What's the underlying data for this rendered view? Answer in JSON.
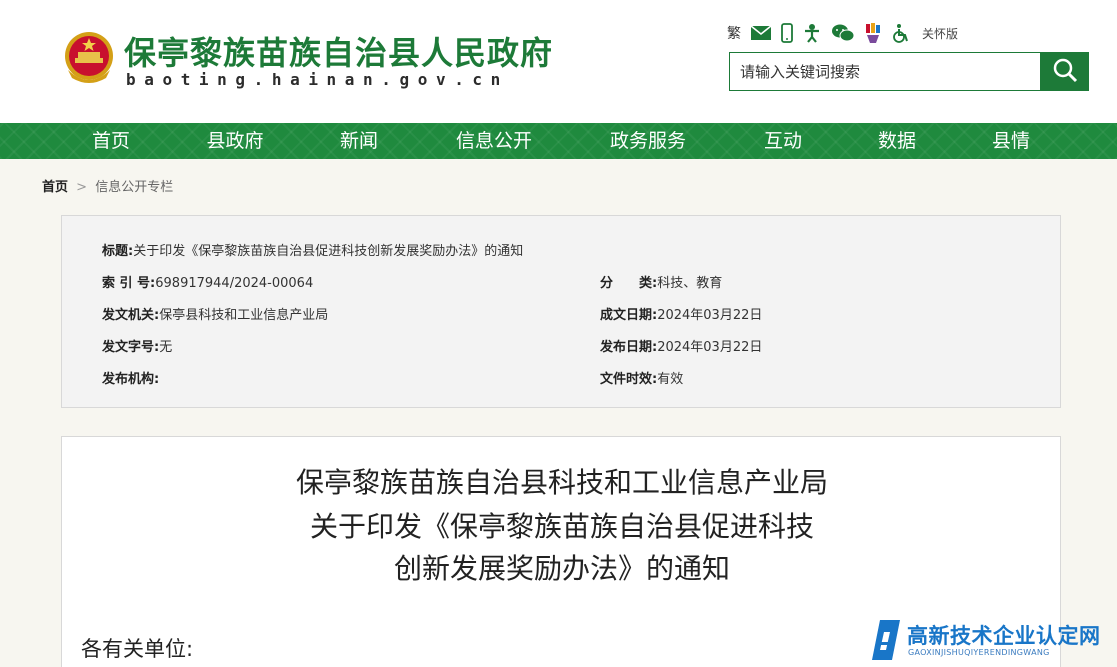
{
  "header": {
    "site_title": "保亭黎族苗族自治县人民政府",
    "site_domain": "baoting.hainan.gov.cn",
    "tools": {
      "traditional_label": "繁",
      "care_mode_label": "关怀版"
    },
    "search": {
      "placeholder": "请输入关键词搜索"
    }
  },
  "nav": {
    "items": [
      {
        "label": "首页"
      },
      {
        "label": "县政府"
      },
      {
        "label": "新闻"
      },
      {
        "label": "信息公开"
      },
      {
        "label": "政务服务"
      },
      {
        "label": "互动"
      },
      {
        "label": "数据"
      },
      {
        "label": "县情"
      }
    ]
  },
  "breadcrumb": {
    "home": "首页",
    "separator": ">",
    "current": "信息公开专栏"
  },
  "info": {
    "title_label": "标题:",
    "title_value": "关于印发《保亭黎族苗族自治县促进科技创新发展奖励办法》的通知",
    "index_label": "索 引 号:",
    "index_value": "698917944/2024-00064",
    "category_label": "分　　类:",
    "category_value": "科技、教育",
    "issuer_label": "发文机关:",
    "issuer_value": "保亭县科技和工业信息产业局",
    "created_label": "成文日期:",
    "created_value": "2024年03月22日",
    "docno_label": "发文字号:",
    "docno_value": "无",
    "published_label": "发布日期:",
    "published_value": "2024年03月22日",
    "org_label": "发布机构:",
    "org_value": "",
    "validity_label": "文件时效:",
    "validity_value": "有效"
  },
  "document": {
    "title_line1": "保亭黎族苗族自治县科技和工业信息产业局",
    "title_line2": "关于印发《保亭黎族苗族自治县促进科技",
    "title_line3": "创新发展奖励办法》的通知",
    "greeting": "各有关单位:"
  },
  "watermark": {
    "text": "高新技术企业认定网",
    "subtext": "GAOXINJISHUQIYERENDINGWANG"
  },
  "colors": {
    "brand_green": "#1d7a38",
    "nav_green": "#1f8a3e",
    "watermark_blue": "#1976c8"
  }
}
